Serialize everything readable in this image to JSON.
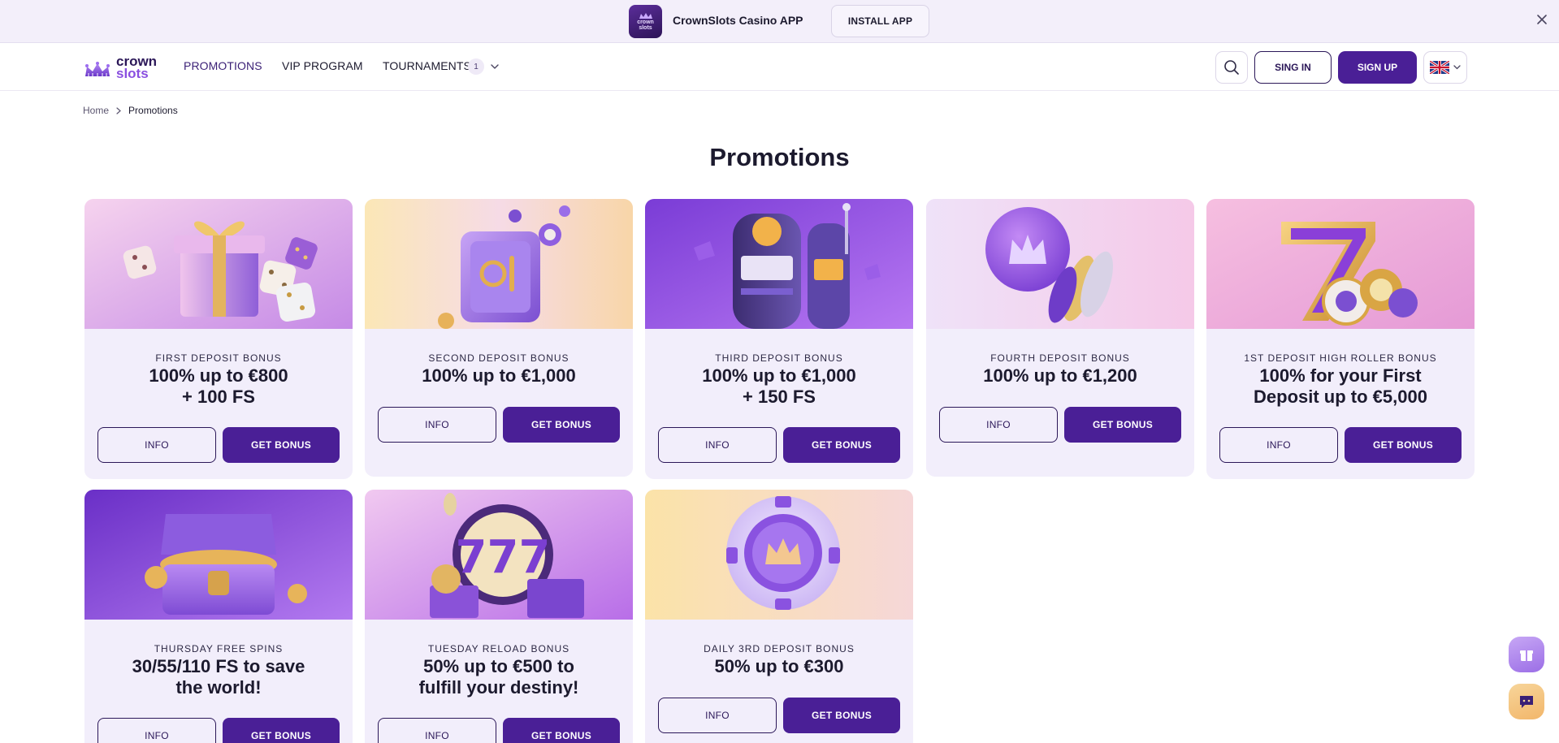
{
  "app_banner": {
    "app_name": "CrownSlots Casino APP",
    "icon_text_line1": "crown",
    "icon_text_line2": "slots",
    "install_label": "INSTALL APP",
    "close_icon": "close-icon"
  },
  "header": {
    "logo_line1": "crown",
    "logo_line2": "slots",
    "nav": {
      "promotions": "PROMOTIONS",
      "vip_program": "VIP PROGRAM",
      "tournaments": "TOURNAMENTS",
      "tournaments_badge": "1"
    },
    "search_icon": "search-icon",
    "signin_label": "SING IN",
    "signup_label": "SIGN UP",
    "language_flag": "uk-flag-icon"
  },
  "breadcrumb": {
    "home": "Home",
    "separator": ">",
    "current": "Promotions"
  },
  "page_title": "Promotions",
  "promotions": [
    {
      "subtitle": "FIRST DEPOSIT BONUS",
      "line1": "100% up to €800",
      "line2": "+ 100 FS",
      "info": "INFO",
      "cta": "GET BONUS",
      "art": "gift-box-dice"
    },
    {
      "subtitle": "SECOND DEPOSIT BONUS",
      "line1": "100% up to €1,000",
      "line2": "",
      "info": "INFO",
      "cta": "GET BONUS",
      "art": "safe-with-chip"
    },
    {
      "subtitle": "THIRD DEPOSIT BONUS",
      "line1": "100% up to €1,000",
      "line2": "+ 150 FS",
      "info": "INFO",
      "cta": "GET BONUS",
      "art": "slot-machine"
    },
    {
      "subtitle": "FOURTH DEPOSIT BONUS",
      "line1": "100% up to €1,200",
      "line2": "",
      "info": "INFO",
      "cta": "GET BONUS",
      "art": "crown-coin-stack"
    },
    {
      "subtitle": "1ST DEPOSIT HIGH ROLLER BONUS",
      "line1": "100% for your First",
      "line2": "Deposit up to €5,000",
      "info": "INFO",
      "cta": "GET BONUS",
      "art": "golden-seven"
    },
    {
      "subtitle": "THURSDAY FREE SPINS",
      "line1": "30/55/110 FS to save",
      "line2": "the world!",
      "info": "INFO",
      "cta": "GET BONUS",
      "art": "treasure-chest"
    },
    {
      "subtitle": "TUESDAY RELOAD BONUS",
      "line1": "50% up to €500 to",
      "line2": "fulfill your destiny!",
      "info": "INFO",
      "cta": "GET BONUS",
      "art": "triple-seven-chips"
    },
    {
      "subtitle": "DAILY 3RD DEPOSIT BONUS",
      "line1": "50% up to €300",
      "line2": "",
      "info": "INFO",
      "cta": "GET BONUS",
      "art": "crown-casino-chip"
    }
  ],
  "floating": {
    "gift_icon": "gift-icon",
    "chat_icon": "chat-icon"
  },
  "colors": {
    "brand_dark": "#2b1758",
    "brand_purple": "#4a1f96",
    "card_bg": "#f2eefb",
    "banner_bg": "#f3effa"
  }
}
